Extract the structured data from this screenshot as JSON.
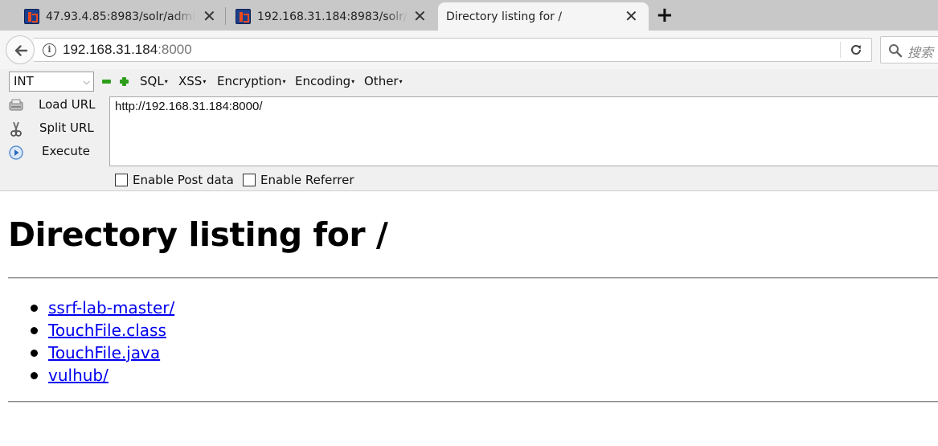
{
  "tabs": [
    {
      "title": "47.93.4.85:8983/solr/admi",
      "active": false
    },
    {
      "title": "192.168.31.184:8983/solr/",
      "active": false
    },
    {
      "title": "Directory listing for /",
      "active": true
    }
  ],
  "tab_close_glyph": "✕",
  "new_tab_glyph": "+",
  "navbar": {
    "url_host": "192.168.31.184",
    "url_port": ":8000",
    "search_placeholder": "搜索"
  },
  "hackbar": {
    "select_value": "INT",
    "menus": {
      "sql": "SQL",
      "xss": "XSS",
      "encryption": "Encryption",
      "encoding": "Encoding",
      "other": "Other"
    },
    "load_url": "Load URL",
    "split_url": "Split URL",
    "execute": "Execute",
    "url_value": "http://192.168.31.184:8000/",
    "enable_post": "Enable Post data",
    "enable_referrer": "Enable Referrer"
  },
  "page": {
    "heading": "Directory listing for /",
    "entries": [
      "ssrf-lab-master/",
      "TouchFile.class",
      "TouchFile.java",
      "vulhub/"
    ]
  },
  "colors": {
    "link": "#0000ee",
    "hackbar_green": "#2e9e1a",
    "tab_bar": "#c8c8c8",
    "toolbar": "#f5f5f5"
  }
}
